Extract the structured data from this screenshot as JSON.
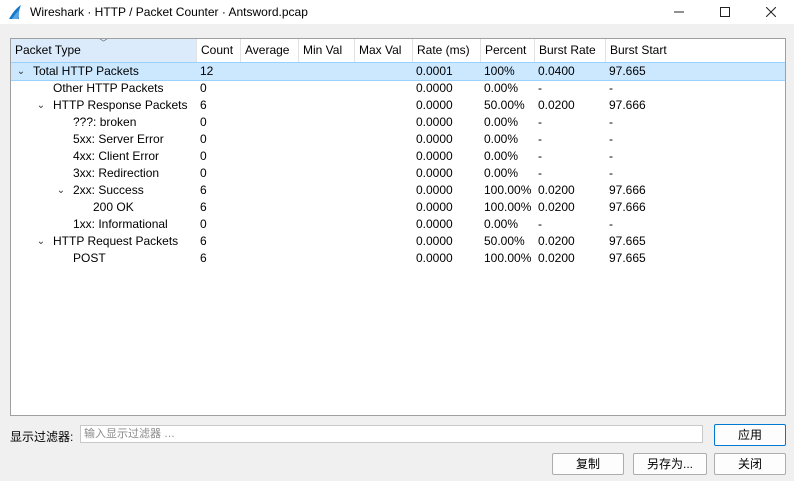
{
  "window": {
    "title": "Wireshark · HTTP / Packet Counter · Antsword.pcap"
  },
  "columns": [
    "Packet Type",
    "Count",
    "Average",
    "Min Val",
    "Max Val",
    "Rate (ms)",
    "Percent",
    "Burst Rate",
    "Burst Start"
  ],
  "rows": [
    {
      "type": "Total HTTP Packets",
      "count": "12",
      "average": "",
      "min": "",
      "max": "",
      "rate": "0.0001",
      "percent": "100%",
      "burst_rate": "0.0400",
      "burst_start": "97.665",
      "expanded": true,
      "selected": true
    },
    {
      "type": "Other HTTP Packets",
      "count": "0",
      "average": "",
      "min": "",
      "max": "",
      "rate": "0.0000",
      "percent": "0.00%",
      "burst_rate": "-",
      "burst_start": "-"
    },
    {
      "type": "HTTP Response Packets",
      "count": "6",
      "average": "",
      "min": "",
      "max": "",
      "rate": "0.0000",
      "percent": "50.00%",
      "burst_rate": "0.0200",
      "burst_start": "97.666",
      "expanded": true
    },
    {
      "type": "???: broken",
      "count": "0",
      "average": "",
      "min": "",
      "max": "",
      "rate": "0.0000",
      "percent": "0.00%",
      "burst_rate": "-",
      "burst_start": "-"
    },
    {
      "type": "5xx: Server Error",
      "count": "0",
      "average": "",
      "min": "",
      "max": "",
      "rate": "0.0000",
      "percent": "0.00%",
      "burst_rate": "-",
      "burst_start": "-"
    },
    {
      "type": "4xx: Client Error",
      "count": "0",
      "average": "",
      "min": "",
      "max": "",
      "rate": "0.0000",
      "percent": "0.00%",
      "burst_rate": "-",
      "burst_start": "-"
    },
    {
      "type": "3xx: Redirection",
      "count": "0",
      "average": "",
      "min": "",
      "max": "",
      "rate": "0.0000",
      "percent": "0.00%",
      "burst_rate": "-",
      "burst_start": "-"
    },
    {
      "type": "2xx: Success",
      "count": "6",
      "average": "",
      "min": "",
      "max": "",
      "rate": "0.0000",
      "percent": "100.00%",
      "burst_rate": "0.0200",
      "burst_start": "97.666",
      "expanded": true
    },
    {
      "type": "200 OK",
      "count": "6",
      "average": "",
      "min": "",
      "max": "",
      "rate": "0.0000",
      "percent": "100.00%",
      "burst_rate": "0.0200",
      "burst_start": "97.666"
    },
    {
      "type": "1xx: Informational",
      "count": "0",
      "average": "",
      "min": "",
      "max": "",
      "rate": "0.0000",
      "percent": "0.00%",
      "burst_rate": "-",
      "burst_start": "-"
    },
    {
      "type": "HTTP Request Packets",
      "count": "6",
      "average": "",
      "min": "",
      "max": "",
      "rate": "0.0000",
      "percent": "50.00%",
      "burst_rate": "0.0200",
      "burst_start": "97.665",
      "expanded": true
    },
    {
      "type": "POST",
      "count": "6",
      "average": "",
      "min": "",
      "max": "",
      "rate": "0.0000",
      "percent": "100.00%",
      "burst_rate": "0.0200",
      "burst_start": "97.665"
    }
  ],
  "filter": {
    "label": "显示过滤器:",
    "placeholder": "输入显示过滤器 …",
    "value": "",
    "apply_label": "应用"
  },
  "buttons": {
    "copy": "复制",
    "save_as": "另存为...",
    "close": "关闭"
  },
  "colors": {
    "selection": "#cce8ff",
    "selection_border": "#99d1ff",
    "sorted_header": "#dcebfc",
    "default_button_border": "#0078d4"
  }
}
